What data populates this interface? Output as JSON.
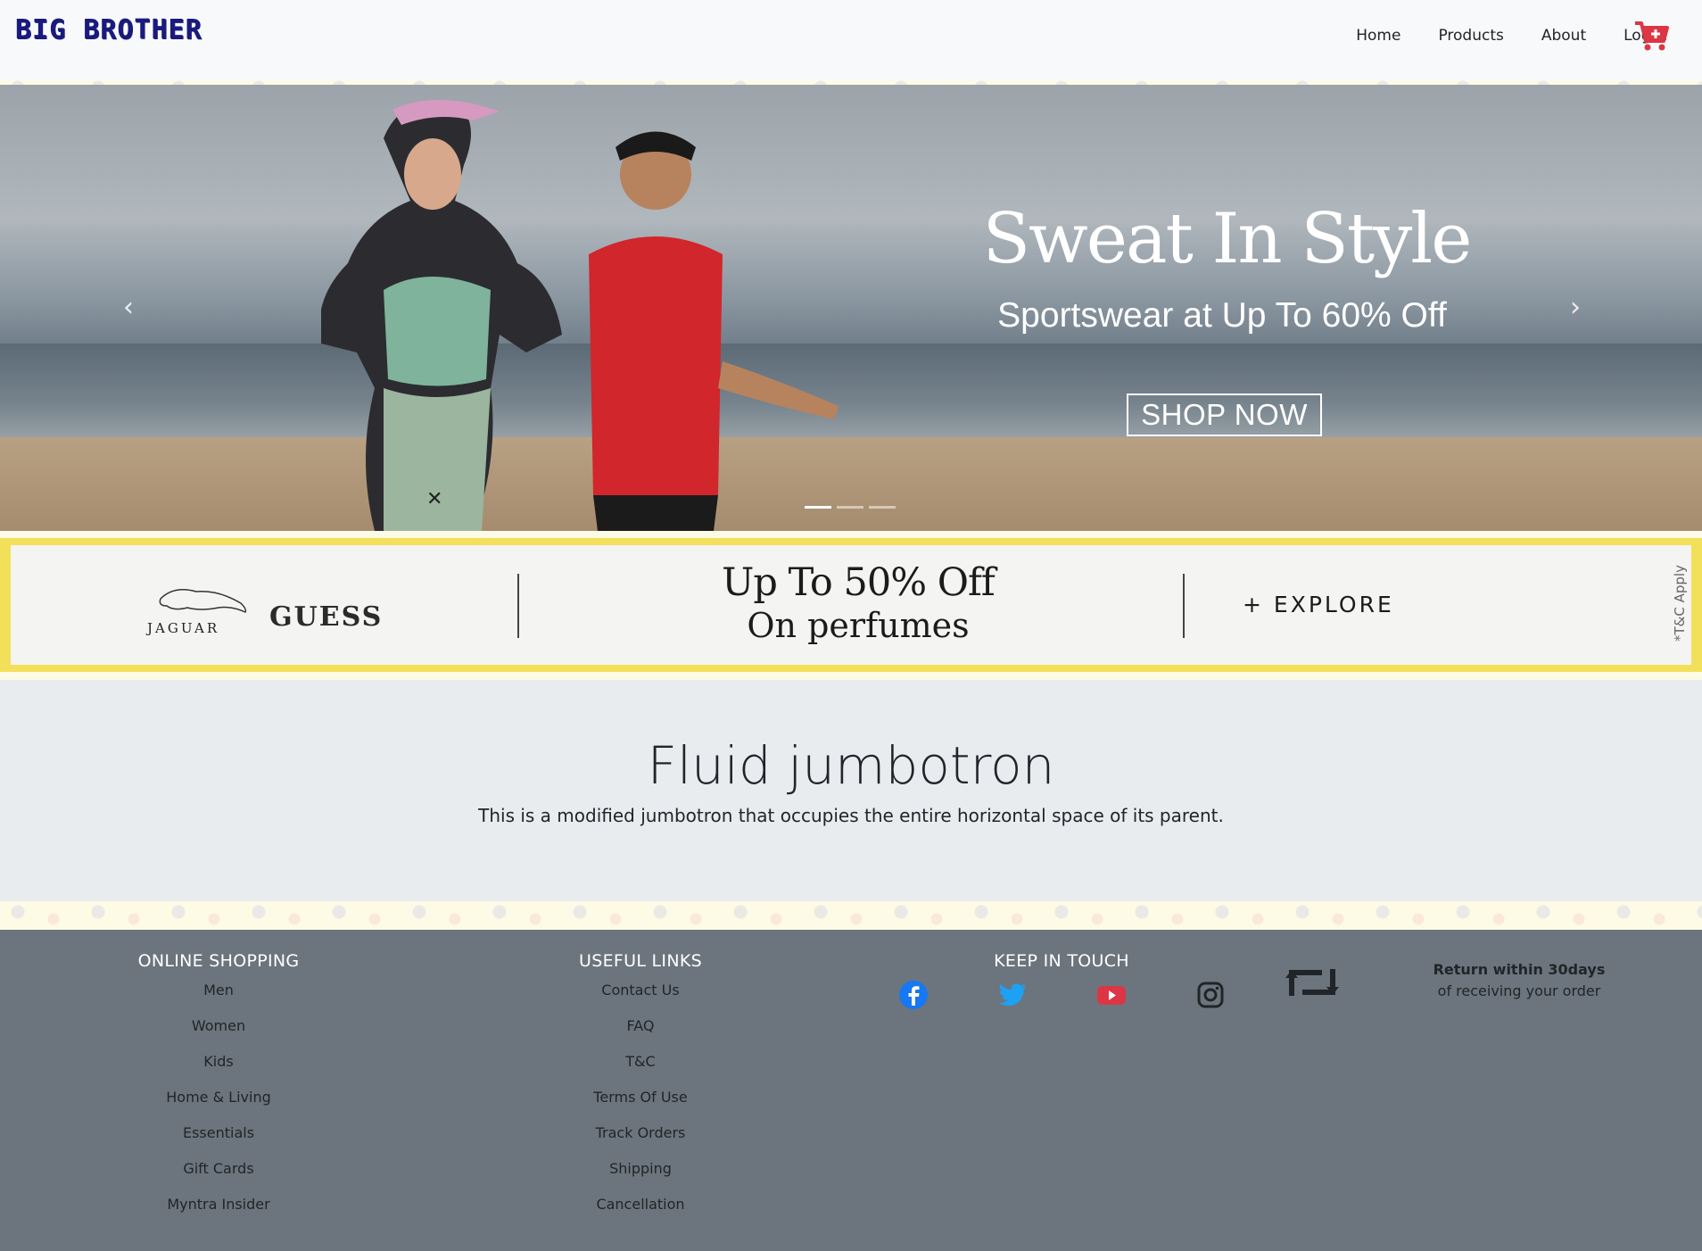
{
  "navbar": {
    "brand": "BIG BROTHER",
    "links": [
      "Home",
      "Products",
      "About",
      "Login"
    ],
    "cart_icon": "cart-plus-icon",
    "cart_color": "#dc3545"
  },
  "hero": {
    "title": "Sweat In Style",
    "subtitle": "Sportswear at Up To 60% Off",
    "cta": "SHOP NOW",
    "prev_icon": "‹",
    "next_icon": "›",
    "slides": 3,
    "active_slide": 1
  },
  "promo": {
    "brand1": "JAGUAR",
    "brand2": "GUESS",
    "headline": "Up To 50% Off",
    "subline": "On perfumes",
    "cta": "+ EXPLORE",
    "disclaimer": "*T&C Apply",
    "border_color": "#f3e05a"
  },
  "jumbotron": {
    "title": "Fluid jumbotron",
    "lead": "This is a modified jumbotron that occupies the entire horizontal space of its parent."
  },
  "footer": {
    "online_shopping": {
      "heading": "ONLINE SHOPPING",
      "links": [
        "Men",
        "Women",
        "Kids",
        "Home & Living",
        "Essentials",
        "Gift Cards",
        "Myntra Insider"
      ]
    },
    "useful_links": {
      "heading": "USEFUL LINKS",
      "links": [
        "Contact Us",
        "FAQ",
        "T&C",
        "Terms Of Use",
        "Track Orders",
        "Shipping",
        "Cancellation"
      ]
    },
    "keep_in_touch": {
      "heading": "KEEP IN TOUCH",
      "icons": [
        "facebook-icon",
        "twitter-icon",
        "youtube-icon",
        "instagram-icon"
      ]
    },
    "return_policy": {
      "title": "Return within 30days",
      "subtitle": "of receiving your order",
      "icon": "return-arrows-icon"
    },
    "bg_color": "#6c757d"
  }
}
